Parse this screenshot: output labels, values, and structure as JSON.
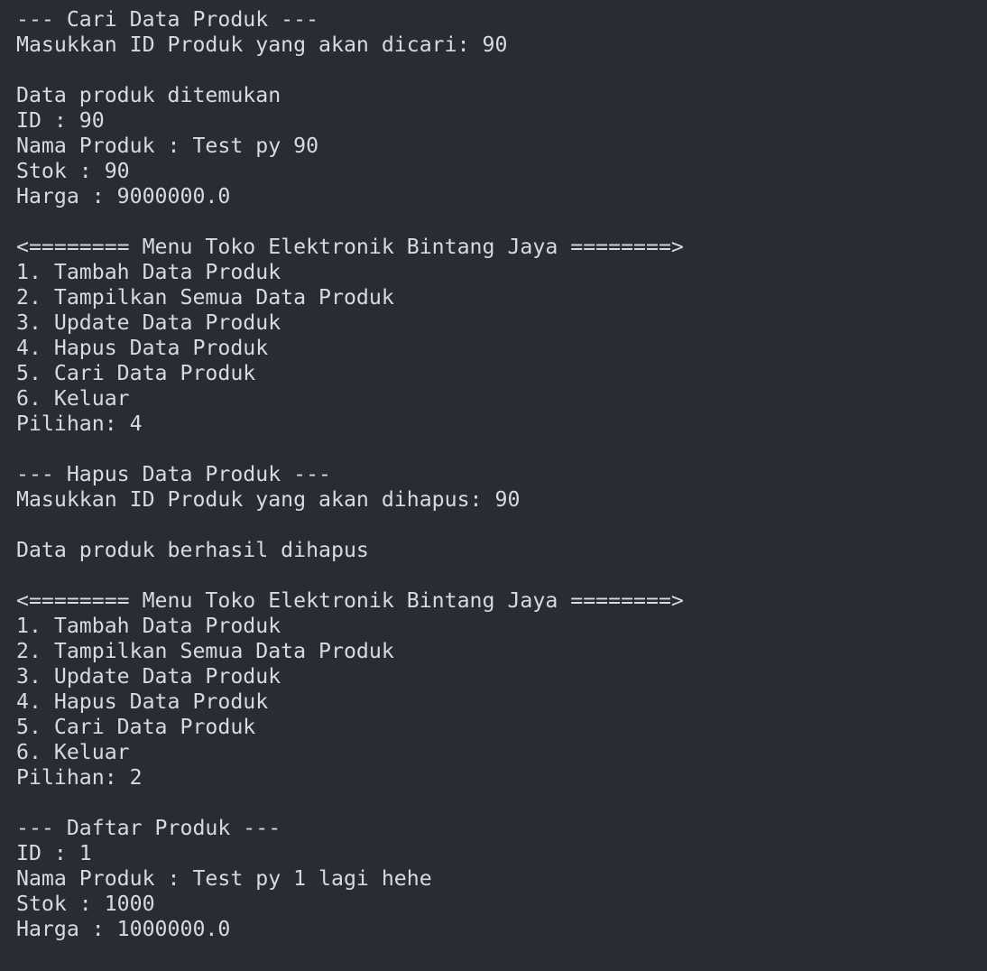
{
  "terminal": {
    "lines": [
      "--- Cari Data Produk ---",
      "Masukkan ID Produk yang akan dicari: 90",
      "",
      "Data produk ditemukan",
      "ID : 90",
      "Nama Produk : Test py 90",
      "Stok : 90",
      "Harga : 9000000.0",
      "",
      "<======== Menu Toko Elektronik Bintang Jaya ========>",
      "1. Tambah Data Produk",
      "2. Tampilkan Semua Data Produk",
      "3. Update Data Produk",
      "4. Hapus Data Produk",
      "5. Cari Data Produk",
      "6. Keluar",
      "Pilihan: 4",
      "",
      "--- Hapus Data Produk ---",
      "Masukkan ID Produk yang akan dihapus: 90",
      "",
      "Data produk berhasil dihapus",
      "",
      "<======== Menu Toko Elektronik Bintang Jaya ========>",
      "1. Tambah Data Produk",
      "2. Tampilkan Semua Data Produk",
      "3. Update Data Produk",
      "4. Hapus Data Produk",
      "5. Cari Data Produk",
      "6. Keluar",
      "Pilihan: 2",
      "",
      "--- Daftar Produk ---",
      "ID : 1",
      "Nama Produk : Test py 1 lagi hehe",
      "Stok : 1000",
      "Harga : 1000000.0"
    ]
  },
  "colors": {
    "background": "#282c34",
    "text": "#d7dae0"
  }
}
